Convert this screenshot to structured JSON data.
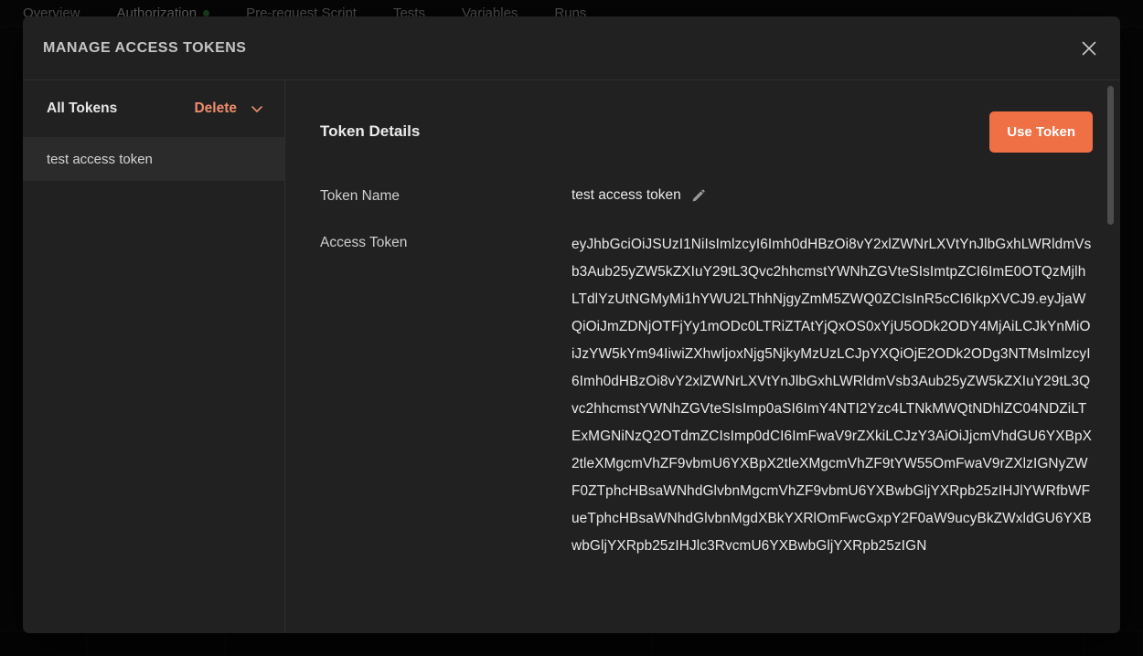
{
  "app": {
    "tabs": [
      {
        "label": "Overview",
        "active": false,
        "dot": false
      },
      {
        "label": "Authorization",
        "active": true,
        "dot": true
      },
      {
        "label": "Pre-request Script",
        "active": false,
        "dot": false
      },
      {
        "label": "Tests",
        "active": false,
        "dot": false
      },
      {
        "label": "Variables",
        "active": false,
        "dot": false
      },
      {
        "label": "Runs",
        "active": false,
        "dot": false
      }
    ]
  },
  "modal": {
    "title": "MANAGE ACCESS TOKENS",
    "close_icon": "close-icon"
  },
  "sidebar": {
    "heading": "All Tokens",
    "delete_label": "Delete",
    "chevron_icon": "chevron-down-icon",
    "tokens": [
      {
        "label": "test access token",
        "selected": true
      }
    ]
  },
  "details": {
    "title": "Token Details",
    "use_token_label": "Use Token",
    "fields": {
      "token_name_label": "Token Name",
      "token_name_value": "test access token",
      "edit_icon": "pencil-icon",
      "access_token_label": "Access Token",
      "access_token_value": "eyJhbGciOiJSUzI1NiIsImlzcyI6Imh0dHBzOi8vY2xlZWNrLXVtYnJlbGxhLWRldmVsb3Aub25yZW5kZXIuY29tL3Qvc2hhcmstYWNhZGVteSIsImtpZCI6ImE0OTQzMjlhLTdlYzUtNGMyMi1hYWU2LThhNjgyZmM5ZWQ0ZCIsInR5cCI6IkpXVCJ9.eyJjaWQiOiJmZDNjOTFjYy1mODc0LTRiZTAtYjQxOS0xYjU5ODk2ODY4MjAiLCJkYnMiOiJzYW5kYm94IiwiZXhwIjoxNjg5NjkyMzUzLCJpYXQiOjE2ODk2ODg3NTMsImlzcyI6Imh0dHBzOi8vY2xlZWNrLXVtYnJlbGxhLWRldmVsb3Aub25yZW5kZXIuY29tL3Qvc2hhcmstYWNhZGVteSIsImp0aSI6ImY4NTI2Yzc4LTNkMWQtNDhlZC04NDZiLTExMGNiNzQ2OTdmZCIsImp0dCI6ImFwaV9rZXkiLCJzY3AiOiJjcmVhdGU6YXBpX2tleXMgcmVhZF9vbmU6YXBpX2tleXMgcmVhZF9tYW55OmFwaV9rZXlzIGNyZWF0ZTphcHBsaWNhdGlvbnMgcmVhZF9vbmU6YXBwbGljYXRpb25zIHJlYWRfbWFueTphcHBsaWNhdGlvbnMgdXBkYXRlOmFwcGxpY2F0aW9ucyBkZWxldGU6YXBwbGljYXRpb25zIHJlc3RvcmU6YXBwbGljYXRpb25zIGN"
    }
  },
  "colors": {
    "accent": "#ee7044",
    "delete": "#ef8d6e",
    "modal_bg": "#212121",
    "selected_row": "#2b2b2b",
    "tab_dot": "#3f9e4d"
  }
}
